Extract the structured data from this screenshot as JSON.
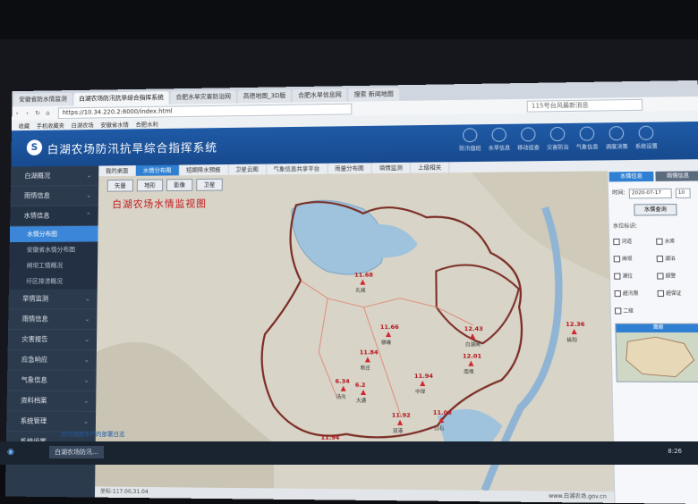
{
  "browser": {
    "tabs": [
      "安徽省防水情监测",
      "白湖农场防汛抗旱综合指挥系统",
      "合肥水旱灾害防治网",
      "高德地图_3D版",
      "合肥水旱信息网",
      "搜索 新闻地图"
    ],
    "url": "https://10.34.220.2:8000/index.html",
    "search_placeholder": "115号台风最新消息",
    "bookmarks": [
      "收藏",
      "手机收藏夹",
      "白湖农场",
      "安徽省水情",
      "合肥水利"
    ]
  },
  "app": {
    "title": "白湖农场防汛抗旱综合指挥系统",
    "logo": "S",
    "header_icons": [
      "防汛值班",
      "水旱信息",
      "移动巡查",
      "灾害防治",
      "气象信息",
      "调度决策",
      "系统设置"
    ]
  },
  "sidebar": {
    "items": [
      {
        "label": "白湖概况"
      },
      {
        "label": "雨情信息"
      },
      {
        "label": "水情信息"
      },
      {
        "label": "旱情监测"
      },
      {
        "label": "雨情信息"
      },
      {
        "label": "灾害报告"
      },
      {
        "label": "应急响应"
      },
      {
        "label": "气象信息"
      },
      {
        "label": "资料档案"
      },
      {
        "label": "系统管理"
      },
      {
        "label": "系统设置"
      }
    ],
    "sub_items": [
      "水情分布图",
      "安徽省水情分布图",
      "闸坝工情概况",
      "圩区排涝概况"
    ]
  },
  "content_tabs": [
    "我的桌面",
    "水情分布图",
    "短期降水预报",
    "卫星云图",
    "气象信息共享平台",
    "雨量分布图",
    "墒情监测",
    "上级相关"
  ],
  "map": {
    "title": "白湖农场水情监视图",
    "buttons": [
      "矢量",
      "地形",
      "影像",
      "卫星"
    ],
    "stations": [
      {
        "value": "11.68",
        "name": "孔城"
      },
      {
        "value": "11.66",
        "name": "柳峰"
      },
      {
        "value": "12.43",
        "name": "白湖闸"
      },
      {
        "value": "12.36",
        "name": "枞阳"
      },
      {
        "value": "11.84",
        "name": "新庄"
      },
      {
        "value": "12.01",
        "name": "南埠"
      },
      {
        "value": "6.34",
        "name": "汤沟"
      },
      {
        "value": "6.2",
        "name": "大通"
      },
      {
        "value": "11.94",
        "name": "中垾"
      },
      {
        "value": "11.03",
        "name": "白石"
      },
      {
        "value": "11.92",
        "name": "双港"
      },
      {
        "value": "11.94",
        "name": "南部"
      },
      {
        "value": "11.94",
        "name": "西部"
      }
    ]
  },
  "statusbar": {
    "left": "坐标:117.00,31.04",
    "right": "www.白湖农场.gov.cn"
  },
  "right_panel": {
    "tabs": [
      "水情信息",
      "雨情信息"
    ],
    "date_label": "时间:",
    "date_value": "2020-07-17",
    "hour_value": "10",
    "query_button": "水情查询",
    "filter_label": "水位标识:",
    "checkboxes": [
      "河道",
      "水库",
      "闸坝",
      "湖泊",
      "潮位",
      "超警",
      "超汛限",
      "超保证",
      "二级"
    ],
    "minimap_title": "鹰眼"
  },
  "taskbar": {
    "start": "◉",
    "active_window": "白湖农场防汛...",
    "link_text": "历代填报水产的部署日志",
    "clock": "8:26"
  }
}
